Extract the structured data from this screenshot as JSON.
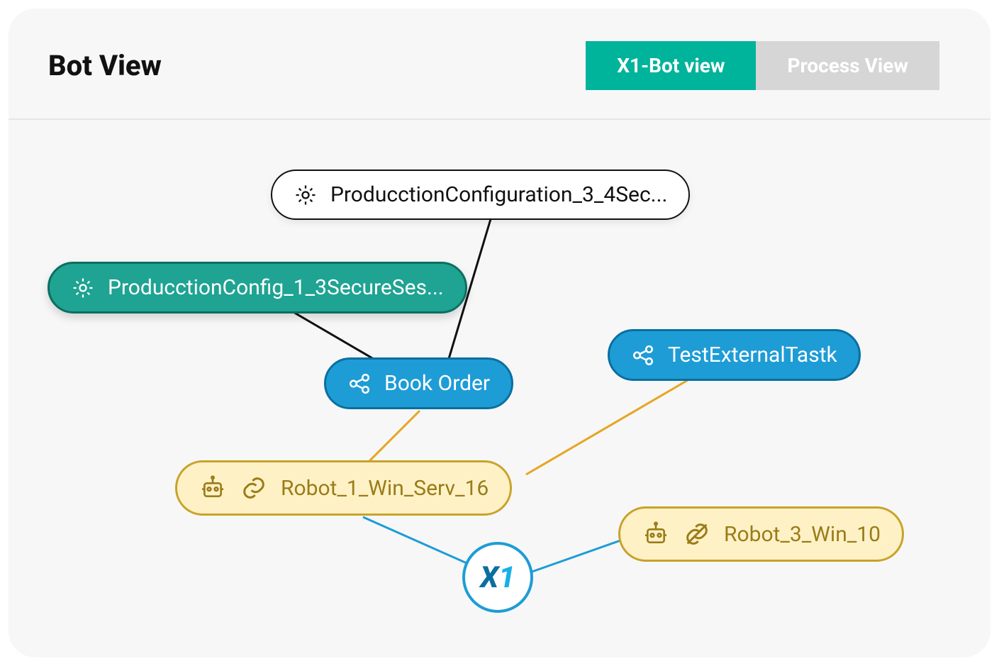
{
  "header": {
    "title": "Bot View",
    "tabs": [
      {
        "label": "X1-Bot view",
        "active": true
      },
      {
        "label": "Process View",
        "active": false
      }
    ]
  },
  "nodes": {
    "config_top": {
      "label": "ProducctionConfiguration_3_4Sec..."
    },
    "config_left": {
      "label": "ProducctionConfig_1_3SecureSes..."
    },
    "task_book": {
      "label": "Book Order"
    },
    "task_ext": {
      "label": "TestExternalTastk"
    },
    "robot1": {
      "label": "Robot_1_Win_Serv_16"
    },
    "robot3": {
      "label": "Robot_3_Win_10"
    },
    "hub": {
      "label": "X1"
    }
  },
  "colors": {
    "teal": "#00b39b",
    "blue": "#1e9cd6",
    "yellow": "#fef1c6",
    "edge_black": "#111",
    "edge_orange": "#e6a522",
    "edge_blue": "#1e9cd6"
  }
}
